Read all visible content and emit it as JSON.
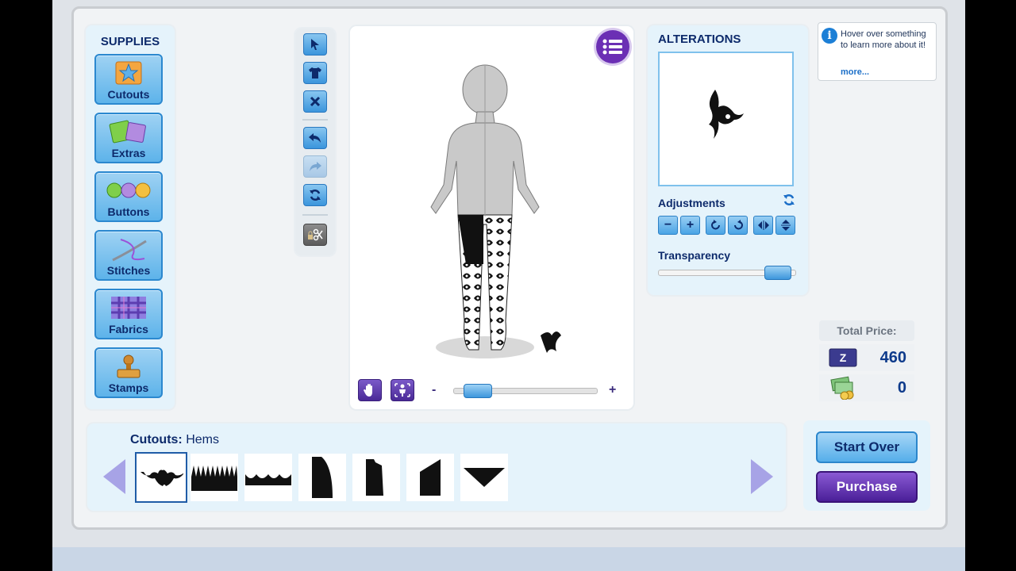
{
  "supplies": {
    "title": "SUPPLIES",
    "items": [
      {
        "label": "Cutouts",
        "icon": "star-cutout-icon"
      },
      {
        "label": "Extras",
        "icon": "patches-icon"
      },
      {
        "label": "Buttons",
        "icon": "buttons-icon"
      },
      {
        "label": "Stitches",
        "icon": "needle-thread-icon"
      },
      {
        "label": "Fabrics",
        "icon": "plaid-fabric-icon"
      },
      {
        "label": "Stamps",
        "icon": "stamp-icon"
      }
    ]
  },
  "tools": [
    "pointer-icon",
    "shirt-icon",
    "remove-icon",
    "undo-icon",
    "redo-icon",
    "refresh-icon",
    "locked-scissors-icon"
  ],
  "canvas": {
    "zoom_minus": "-",
    "zoom_plus": "+",
    "zoom_level": 0.08
  },
  "alterations": {
    "title": "ALTERATIONS",
    "adjustments_label": "Adjustments",
    "transparency_label": "Transparency",
    "transparency_level": 0.95,
    "adjust_buttons": [
      "−",
      "+"
    ]
  },
  "info": {
    "text": "Hover over something to learn more about it!",
    "more": "more..."
  },
  "price": {
    "header": "Total Price:",
    "zbucks": "460",
    "coins": "0"
  },
  "cutouts": {
    "category": "Cutouts:",
    "subcategory": "Hems",
    "items": [
      "ornate-hem",
      "spiky-hem",
      "scalloped-hem",
      "curved-hem",
      "jagged-hem",
      "slanted-hem",
      "v-hem"
    ]
  },
  "actions": {
    "start_over": "Start Over",
    "purchase": "Purchase"
  },
  "colors": {
    "navy": "#0d2a6b",
    "purple": "#6b2fb4",
    "sky": "#5db3ea"
  }
}
